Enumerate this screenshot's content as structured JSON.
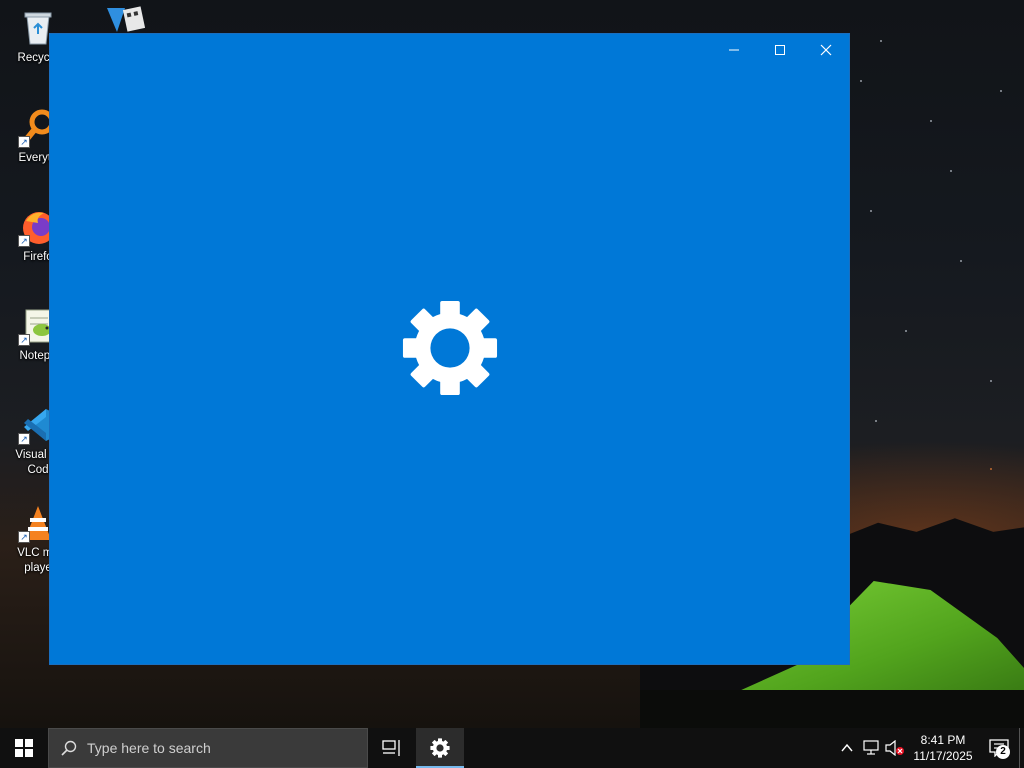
{
  "desktop": {
    "icons": [
      {
        "label": "Recycle",
        "icon": "recycle-bin-icon"
      },
      {
        "label": "Everyth",
        "icon": "everything-search-icon"
      },
      {
        "label": "Firefo",
        "icon": "firefox-icon"
      },
      {
        "label": "Notepa",
        "icon": "notepad-plus-plus-icon"
      },
      {
        "label": "Visual St",
        "label2": "Cod",
        "icon": "vscode-icon"
      },
      {
        "label": "VLC me",
        "label2": "playe",
        "icon": "vlc-icon"
      }
    ],
    "second_column_icon": "video-editor-icon"
  },
  "window": {
    "background": "#0078d7",
    "controls": [
      "minimize",
      "maximize",
      "close"
    ],
    "splash_icon": "settings-gear-icon"
  },
  "taskbar": {
    "search_placeholder": "Type here to search",
    "pinned": [
      {
        "name": "task-view",
        "icon": "task-view-icon"
      },
      {
        "name": "settings",
        "icon": "gear-icon",
        "active": true
      }
    ],
    "tray": {
      "time": "8:41 PM",
      "date": "11/17/2025",
      "notification_count": "2"
    },
    "accent": "#76b9ed"
  }
}
